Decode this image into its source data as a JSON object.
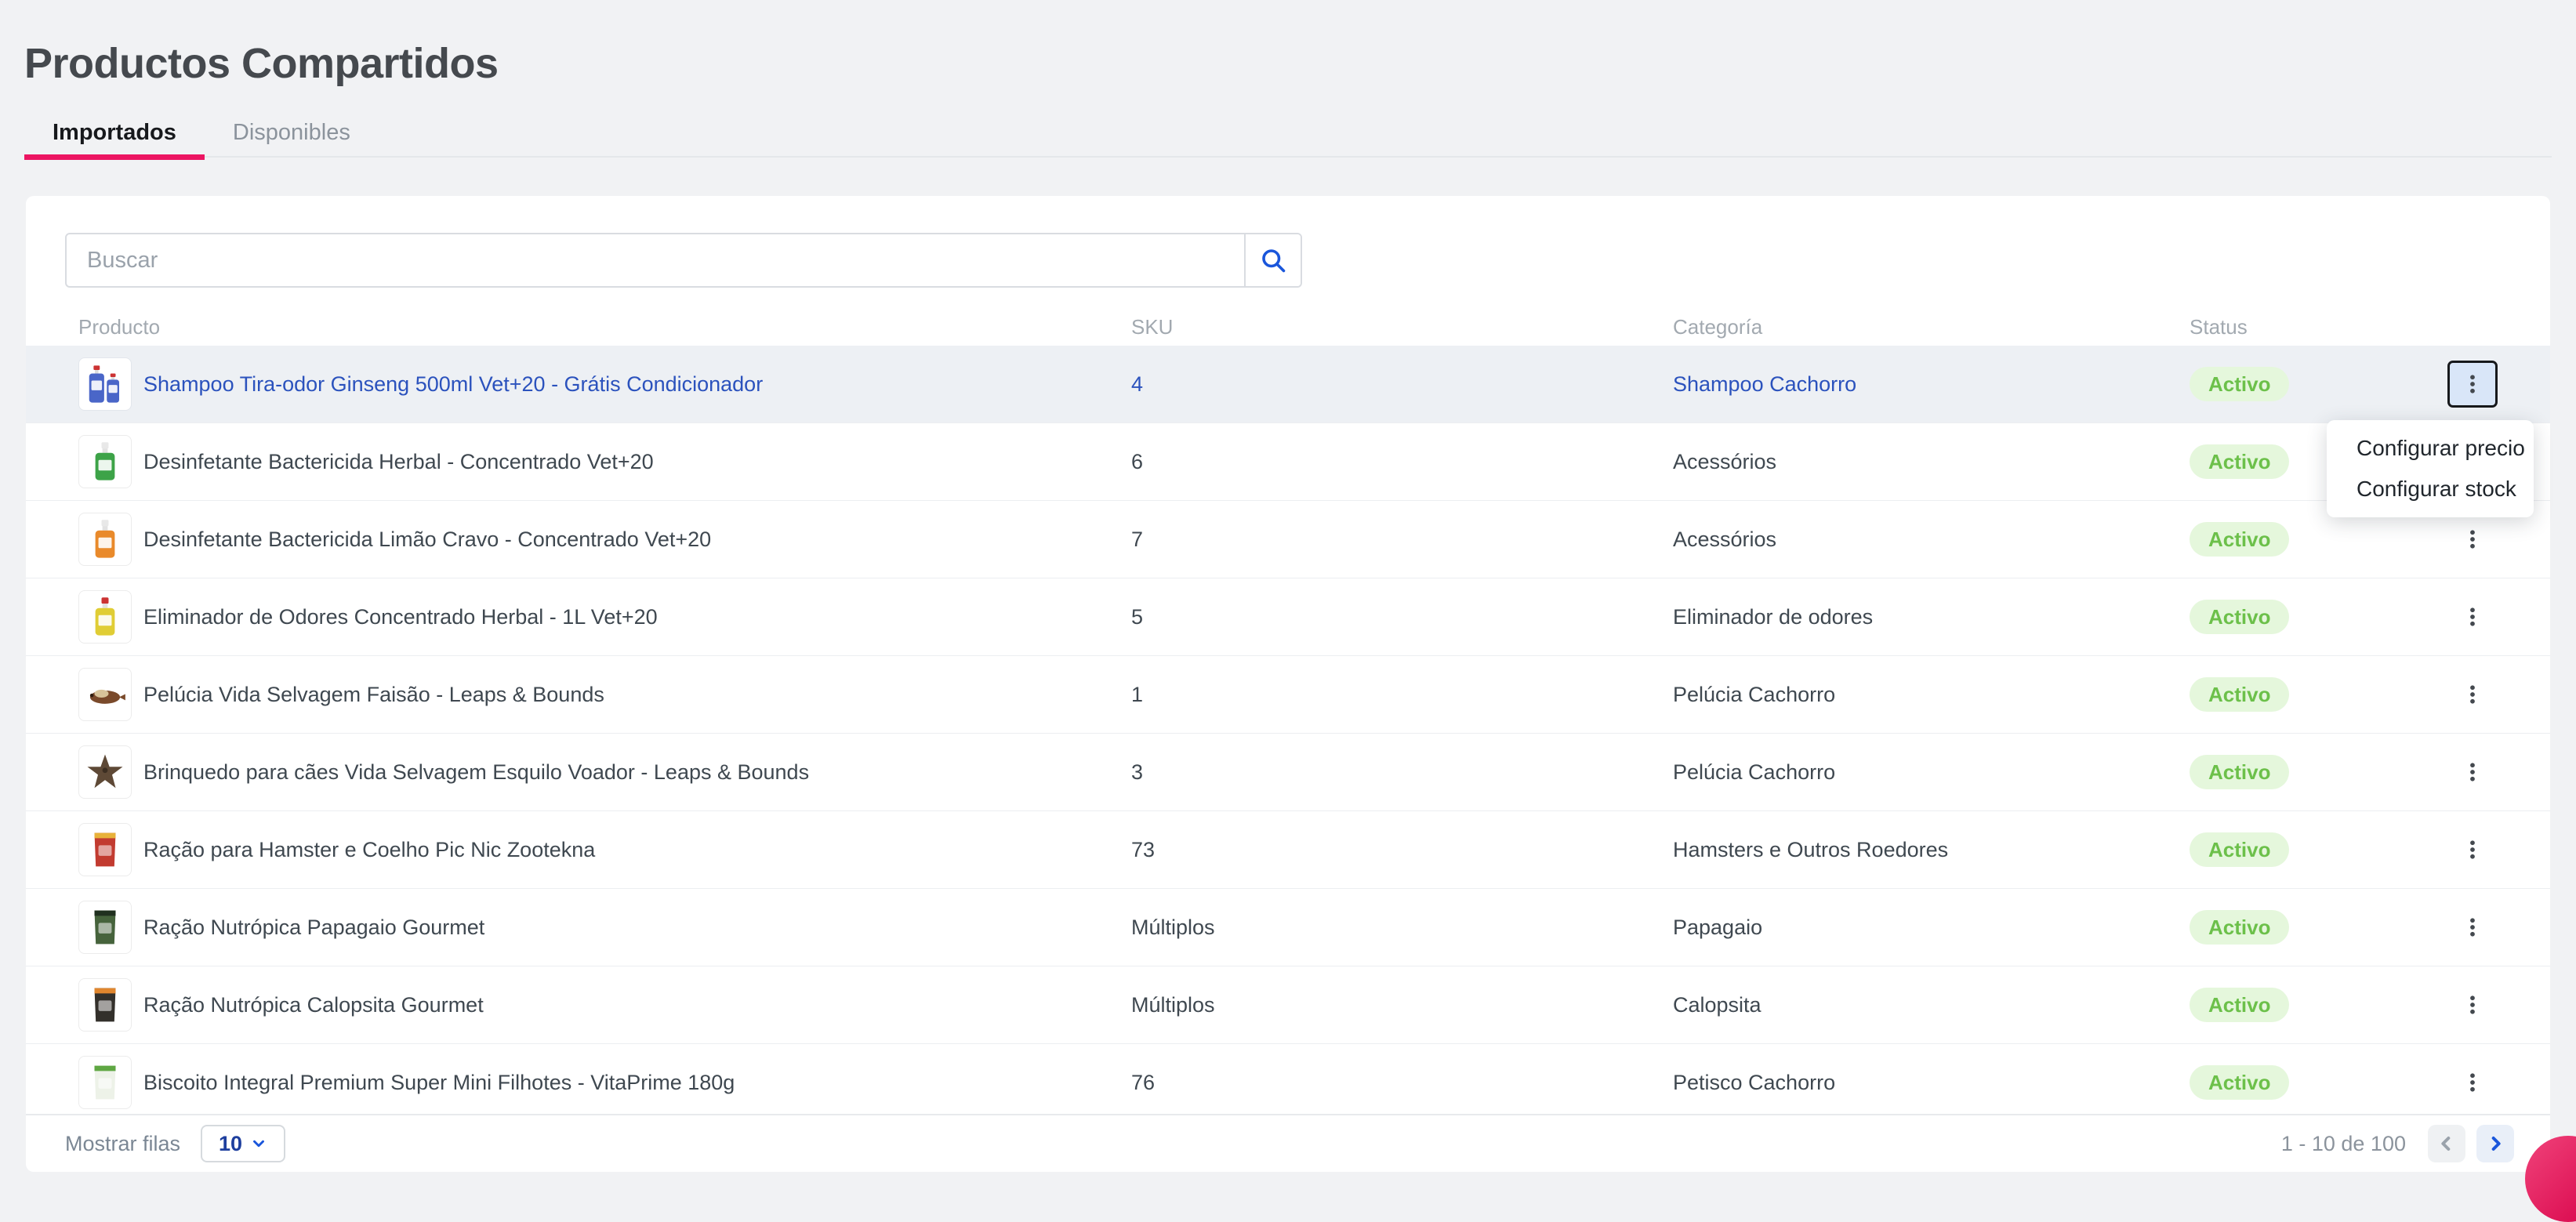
{
  "page": {
    "title": "Productos Compartidos"
  },
  "tabs": [
    {
      "label": "Importados",
      "active": true
    },
    {
      "label": "Disponibles",
      "active": false
    }
  ],
  "search": {
    "placeholder": "Buscar",
    "icon": "search-icon"
  },
  "table": {
    "columns": [
      "Producto",
      "SKU",
      "Categoría",
      "Status"
    ]
  },
  "products": [
    {
      "name": "Shampoo Tira-odor Ginseng 500ml Vet+20 - Grátis Condicionador",
      "sku": "4",
      "category": "Shampoo Cachorro",
      "status": "Activo",
      "highlighted": true,
      "thumb": {
        "kind": "bottles-pair",
        "primary": "#4a66c8",
        "secondary": "#cc3333"
      }
    },
    {
      "name": "Desinfetante Bactericida Herbal - Concentrado Vet+20",
      "sku": "6",
      "category": "Acessórios",
      "status": "Activo",
      "highlighted": false,
      "thumb": {
        "kind": "bottle",
        "primary": "#3da348",
        "secondary": "#e8e8e8"
      }
    },
    {
      "name": "Desinfetante Bactericida Limão Cravo - Concentrado Vet+20",
      "sku": "7",
      "category": "Acessórios",
      "status": "Activo",
      "highlighted": false,
      "thumb": {
        "kind": "bottle",
        "primary": "#e98a2b",
        "secondary": "#e8e8e8"
      }
    },
    {
      "name": "Eliminador de Odores Concentrado Herbal - 1L Vet+20",
      "sku": "5",
      "category": "Eliminador de odores",
      "status": "Activo",
      "highlighted": false,
      "thumb": {
        "kind": "bottle",
        "primary": "#e0cd35",
        "secondary": "#cc3333"
      }
    },
    {
      "name": "Pelúcia Vida Selvagem Faisão - Leaps & Bounds",
      "sku": "1",
      "category": "Pelúcia Cachorro",
      "status": "Activo",
      "highlighted": false,
      "thumb": {
        "kind": "plush-bird",
        "primary": "#7a4a2b",
        "secondary": "#d8c49a"
      }
    },
    {
      "name": "Brinquedo para cães Vida Selvagem Esquilo Voador - Leaps & Bounds",
      "sku": "3",
      "category": "Pelúcia Cachorro",
      "status": "Activo",
      "highlighted": false,
      "thumb": {
        "kind": "plush-star",
        "primary": "#5e4936",
        "secondary": "#3c2e21"
      }
    },
    {
      "name": "Ração para Hamster e Coelho Pic Nic Zootekna",
      "sku": "73",
      "category": "Hamsters e Outros Roedores",
      "status": "Activo",
      "highlighted": false,
      "thumb": {
        "kind": "packet",
        "primary": "#c23b30",
        "secondary": "#e8b23a"
      }
    },
    {
      "name": "Ração Nutrópica Papagaio Gourmet",
      "sku": "Múltiplos",
      "category": "Papagaio",
      "status": "Activo",
      "highlighted": false,
      "thumb": {
        "kind": "packet",
        "primary": "#46633c",
        "secondary": "#20301f"
      }
    },
    {
      "name": "Ração Nutrópica Calopsita Gourmet",
      "sku": "Múltiplos",
      "category": "Calopsita",
      "status": "Activo",
      "highlighted": false,
      "thumb": {
        "kind": "packet",
        "primary": "#33302b",
        "secondary": "#e0862e"
      }
    },
    {
      "name": "Biscoito Integral Premium Super Mini Filhotes - VitaPrime 180g",
      "sku": "76",
      "category": "Petisco Cachorro",
      "status": "Activo",
      "highlighted": false,
      "thumb": {
        "kind": "packet",
        "primary": "#edf2e8",
        "secondary": "#5fa743"
      }
    }
  ],
  "context_menu": {
    "items": [
      "Configurar precio",
      "Configurar stock"
    ]
  },
  "pagination": {
    "rows_label": "Mostrar filas",
    "page_size": "10",
    "range_label": "1 - 10 de 100"
  },
  "colors": {
    "accent_pink": "#ec1562",
    "link_blue": "#2b52bd",
    "primary_blue": "#1a56db",
    "badge_bg": "#e5f7dc",
    "badge_text": "#6cc04a",
    "text_dark": "#3f4850",
    "text_gray": "#8b939c",
    "header_gray": "#a2a9b0",
    "row_highlight": "#edf0f4"
  }
}
